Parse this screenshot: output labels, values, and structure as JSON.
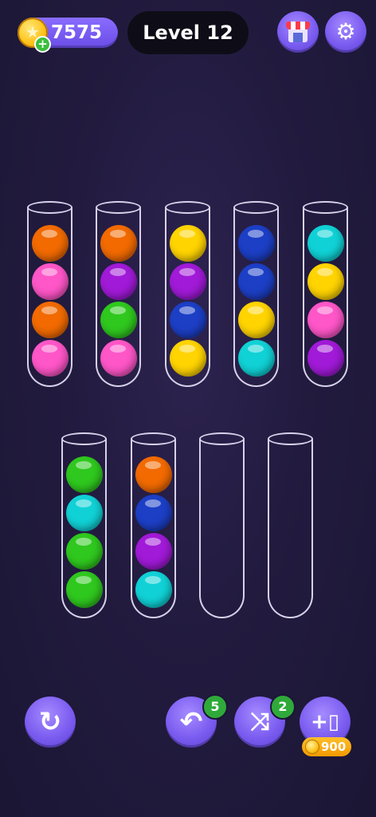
{
  "hud": {
    "coins": "7575",
    "coin_plus": "+",
    "level": "Level 12",
    "coin_icon": "star-coin-icon",
    "shop_icon": "shop-icon",
    "settings_icon": "gear-icon"
  },
  "colors": {
    "orange": "#f26a00",
    "pink": "#ff56c8",
    "purple": "#a11ad8",
    "green": "#2fc81e",
    "yellow": "#ffd400",
    "blue": "#1c3fc6",
    "cyan": "#10d2d6"
  },
  "tubes": [
    {
      "balls_top_to_bottom": [
        "orange",
        "pink",
        "orange",
        "pink"
      ]
    },
    {
      "balls_top_to_bottom": [
        "orange",
        "purple",
        "green",
        "pink"
      ]
    },
    {
      "balls_top_to_bottom": [
        "yellow",
        "purple",
        "blue",
        "yellow"
      ]
    },
    {
      "balls_top_to_bottom": [
        "blue",
        "blue",
        "yellow",
        "cyan"
      ]
    },
    {
      "balls_top_to_bottom": [
        "cyan",
        "yellow",
        "pink",
        "purple"
      ]
    },
    {
      "balls_top_to_bottom": [
        "green",
        "cyan",
        "green",
        "green"
      ]
    },
    {
      "balls_top_to_bottom": [
        "orange",
        "blue",
        "purple",
        "cyan"
      ]
    },
    {
      "balls_top_to_bottom": []
    },
    {
      "balls_top_to_bottom": []
    }
  ],
  "controls": {
    "restart_icon": "restart-icon",
    "undo_icon": "undo-arrow-icon",
    "undo_count": "5",
    "shuffle_icon": "shuffle-icon",
    "shuffle_count": "2",
    "add_tube_icon": "add-tube-icon",
    "add_tube_price": "900"
  }
}
